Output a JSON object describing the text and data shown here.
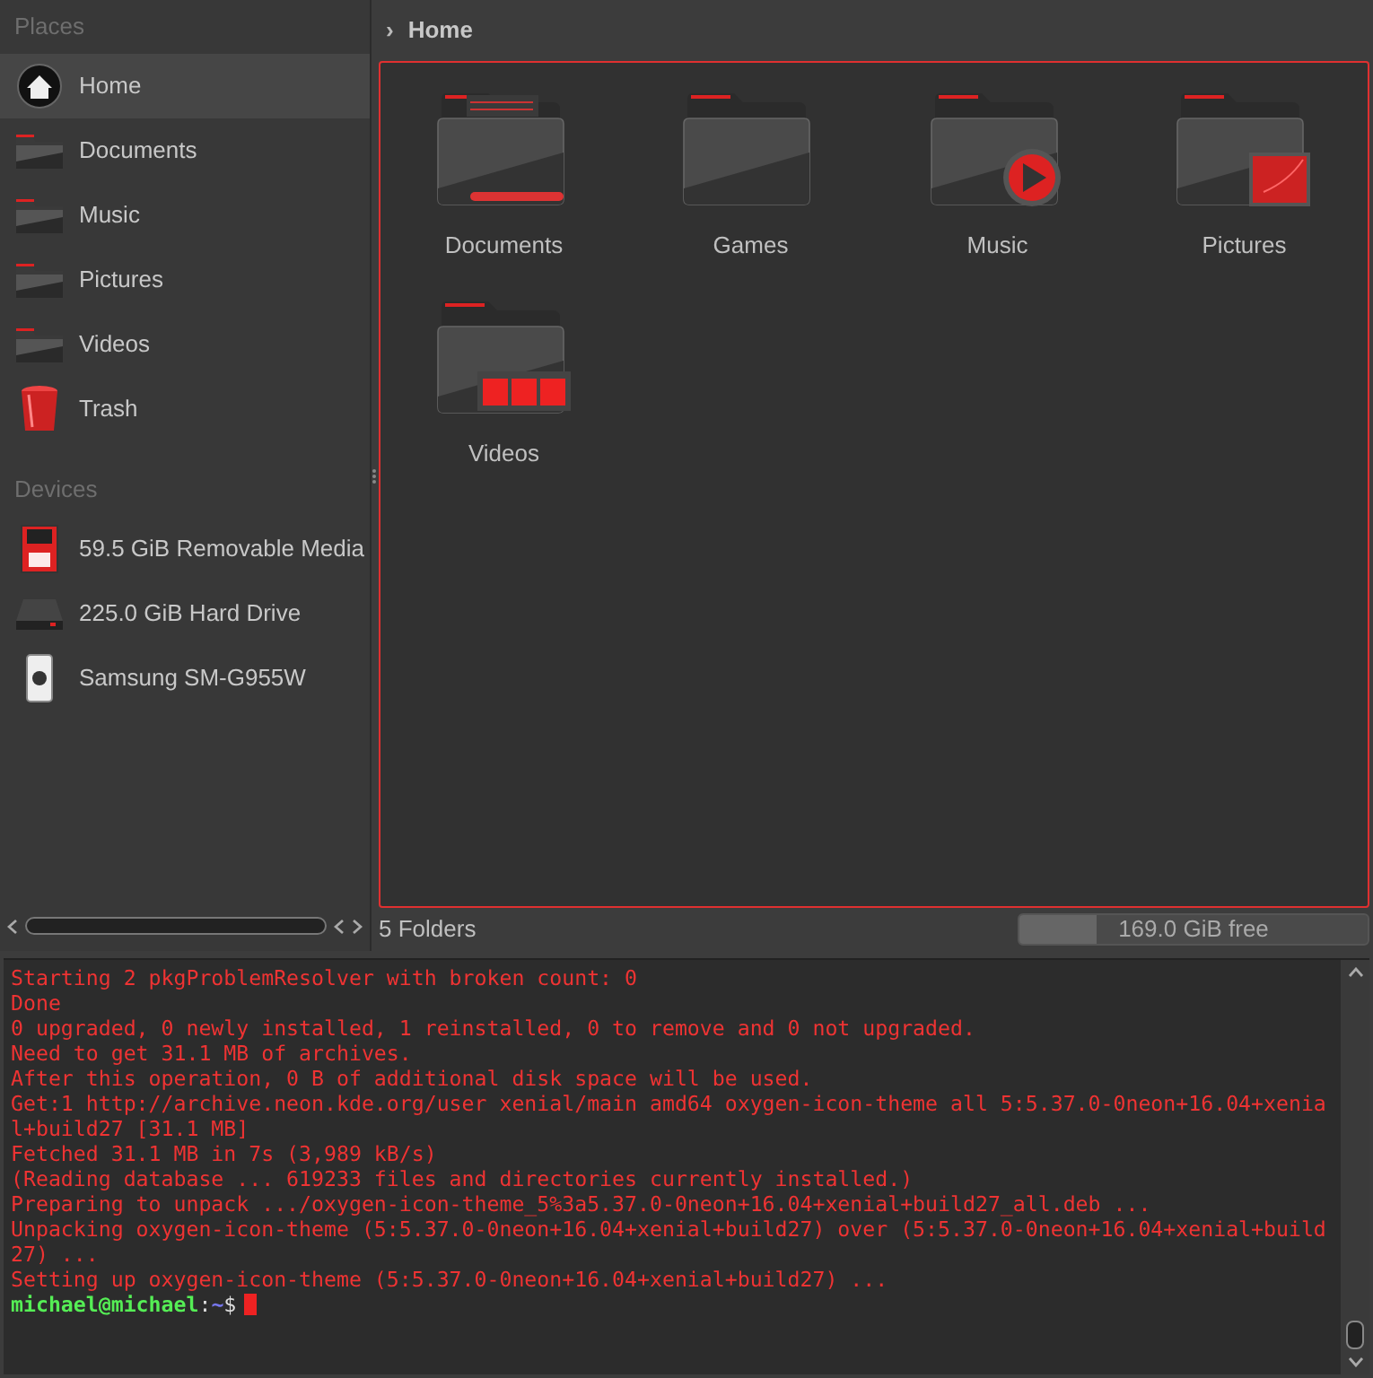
{
  "sidebar": {
    "sections": [
      {
        "title": "Places",
        "items": [
          {
            "label": "Home",
            "kind": "home",
            "selected": true
          },
          {
            "label": "Documents",
            "kind": "folder",
            "selected": false
          },
          {
            "label": "Music",
            "kind": "folder",
            "selected": false
          },
          {
            "label": "Pictures",
            "kind": "folder",
            "selected": false
          },
          {
            "label": "Videos",
            "kind": "folder",
            "selected": false
          },
          {
            "label": "Trash",
            "kind": "trash",
            "selected": false
          }
        ]
      },
      {
        "title": "Devices",
        "items": [
          {
            "label": "59.5 GiB Removable Media",
            "kind": "sd",
            "selected": false
          },
          {
            "label": "225.0 GiB Hard Drive",
            "kind": "hdd",
            "selected": false
          },
          {
            "label": "Samsung SM-G955W",
            "kind": "phone",
            "selected": false
          }
        ]
      }
    ]
  },
  "breadcrumb": {
    "separator": "›",
    "location": "Home"
  },
  "folders": [
    {
      "label": "Documents",
      "kind": "documents"
    },
    {
      "label": "Games",
      "kind": "plain"
    },
    {
      "label": "Music",
      "kind": "music"
    },
    {
      "label": "Pictures",
      "kind": "pictures"
    },
    {
      "label": "Videos",
      "kind": "videos"
    }
  ],
  "status_bar": {
    "count": "5 Folders",
    "free_space": {
      "label": "169.0 GiB free",
      "level": 0.22
    }
  },
  "terminal": {
    "lines": [
      "Starting 2 pkgProblemResolver with broken count: 0",
      "Done",
      "0 upgraded, 0 newly installed, 1 reinstalled, 0 to remove and 0 not upgraded.",
      "Need to get 31.1 MB of archives.",
      "After this operation, 0 B of additional disk space will be used.",
      "Get:1 http://archive.neon.kde.org/user xenial/main amd64 oxygen-icon-theme all 5:5.37.0-0neon+16.04+xenial+build27 [31.1 MB]",
      "Fetched 31.1 MB in 7s (3,989 kB/s)",
      "(Reading database ... 619233 files and directories currently installed.)",
      "Preparing to unpack .../oxygen-icon-theme_5%3a5.37.0-0neon+16.04+xenial+build27_all.deb ...",
      "Unpacking oxygen-icon-theme (5:5.37.0-0neon+16.04+xenial+build27) over (5:5.37.0-0neon+16.04+xenial+build27) ...",
      "Setting up oxygen-icon-theme (5:5.37.0-0neon+16.04+xenial+build27) ..."
    ],
    "prompt": {
      "user": "michael@michael",
      "separator": ":",
      "path": "~",
      "symbol": "$"
    }
  }
}
